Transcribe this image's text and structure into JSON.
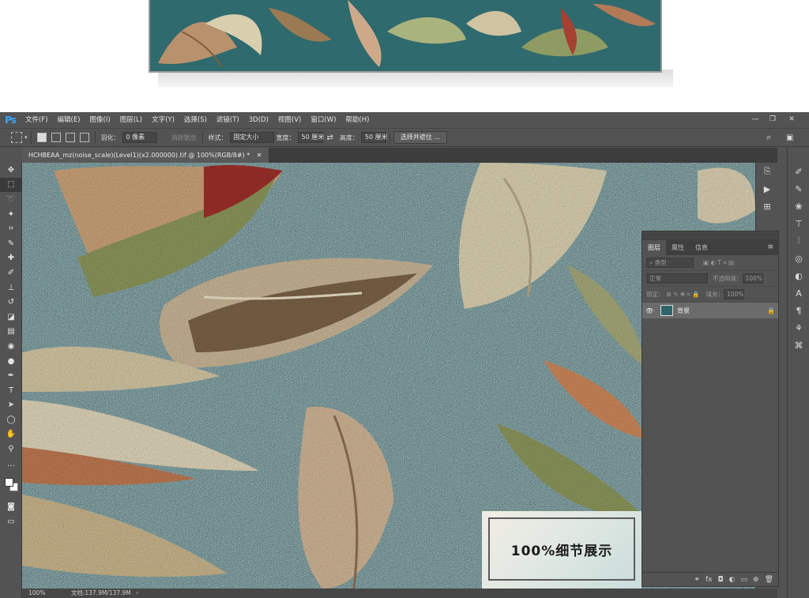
{
  "app": {
    "logo": "Ps"
  },
  "menu": [
    "文件(F)",
    "编辑(E)",
    "图像(I)",
    "图层(L)",
    "文字(Y)",
    "选择(S)",
    "滤镜(T)",
    "3D(D)",
    "视图(V)",
    "窗口(W)",
    "帮助(H)"
  ],
  "options": {
    "feather_label": "羽化：",
    "feather_value": "0 像素",
    "antialias_label": "消除锯齿",
    "style_label": "样式：",
    "style_value": "固定大小",
    "width_label": "宽度：",
    "width_value": "50 厘米",
    "height_label": "高度：",
    "height_value": "50 厘米",
    "select_mask_button": "选择并遮住 ..."
  },
  "document": {
    "tab_title": "HCHBEAA_mz(noise_scale)(Level1)(x2.000000).tif @ 100%(RGB/8#) *",
    "zoom": "100%",
    "doc_info": "文档:137.9M/137.9M"
  },
  "layers_panel": {
    "tabs": [
      "图层",
      "属性",
      "信息"
    ],
    "search_placeholder": "类型",
    "blend_mode": "正常",
    "opacity_label": "不透明度：",
    "opacity_value": "100%",
    "lock_label": "锁定：",
    "fill_label": "填充：",
    "fill_value": "100%",
    "layer_name": "背景"
  },
  "badge": {
    "text": "100%细节展示"
  },
  "colors": {
    "ps_blue": "#31a8ff",
    "canvas_teal": "#2d6468",
    "panel": "#535353"
  }
}
